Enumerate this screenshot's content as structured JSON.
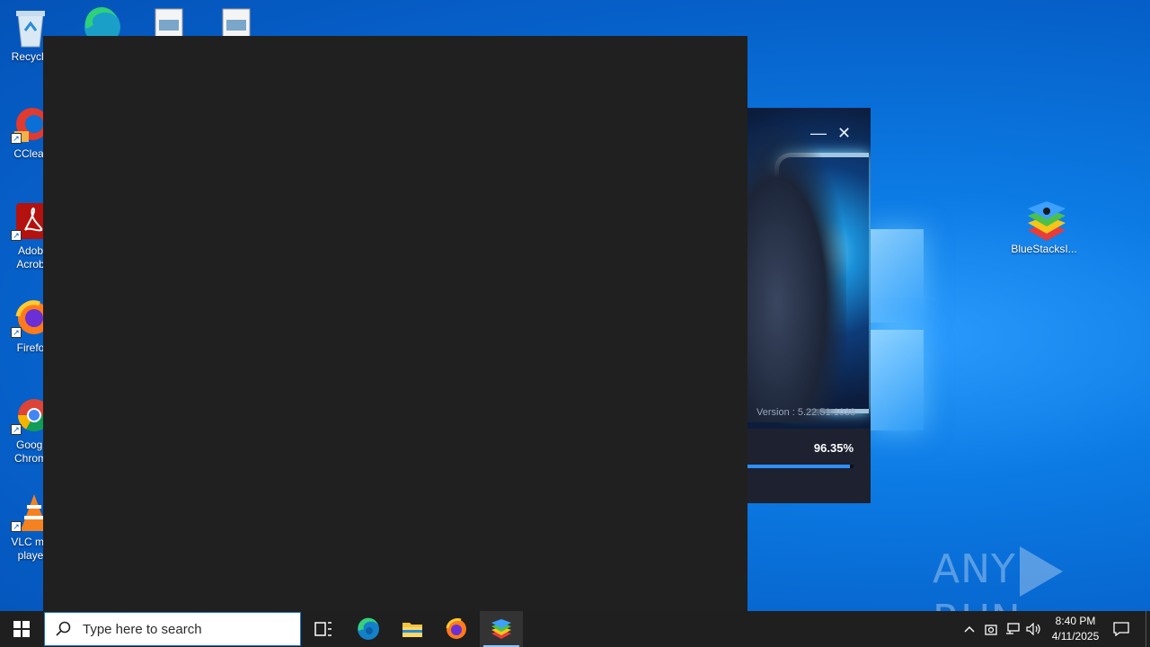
{
  "desktop": {
    "icons_left": [
      {
        "label": "Recycle",
        "icon": "recycle-bin-icon"
      },
      {
        "label": "CClear",
        "icon": "ccleaner-icon"
      },
      {
        "label": "Adob\nAcrob",
        "icon": "adobe-acrobat-icon"
      },
      {
        "label": "Firefo",
        "icon": "firefox-icon"
      },
      {
        "label": "Googl\nChrom",
        "icon": "chrome-icon"
      },
      {
        "label": "VLC me\nplaye",
        "icon": "vlc-icon"
      }
    ],
    "icons_top": [
      {
        "icon": "edge-icon"
      },
      {
        "icon": "image-file-icon"
      },
      {
        "icon": "image-file-icon"
      }
    ],
    "icon_right": {
      "label": "BlueStacksI...",
      "icon": "bluestacks-icon"
    }
  },
  "installer": {
    "minimize_glyph": "—",
    "close_glyph": "✕",
    "version": "Version : 5.22.51.1038",
    "progress_text": "96.35%",
    "progress_value": 0.9635
  },
  "watermark": {
    "left": "ANY",
    "right": "RUN"
  },
  "taskbar": {
    "search_placeholder": "Type here to search",
    "apps": [
      "task-view-icon",
      "edge-icon",
      "file-explorer-icon",
      "firefox-icon",
      "bluestacks-icon"
    ],
    "clock_time": "8:40 PM",
    "clock_date": "4/11/2025"
  },
  "colors": {
    "taskbar": "#1f1f1f",
    "overlay_window": "#202020",
    "installer_progress": "#2d8fff"
  }
}
